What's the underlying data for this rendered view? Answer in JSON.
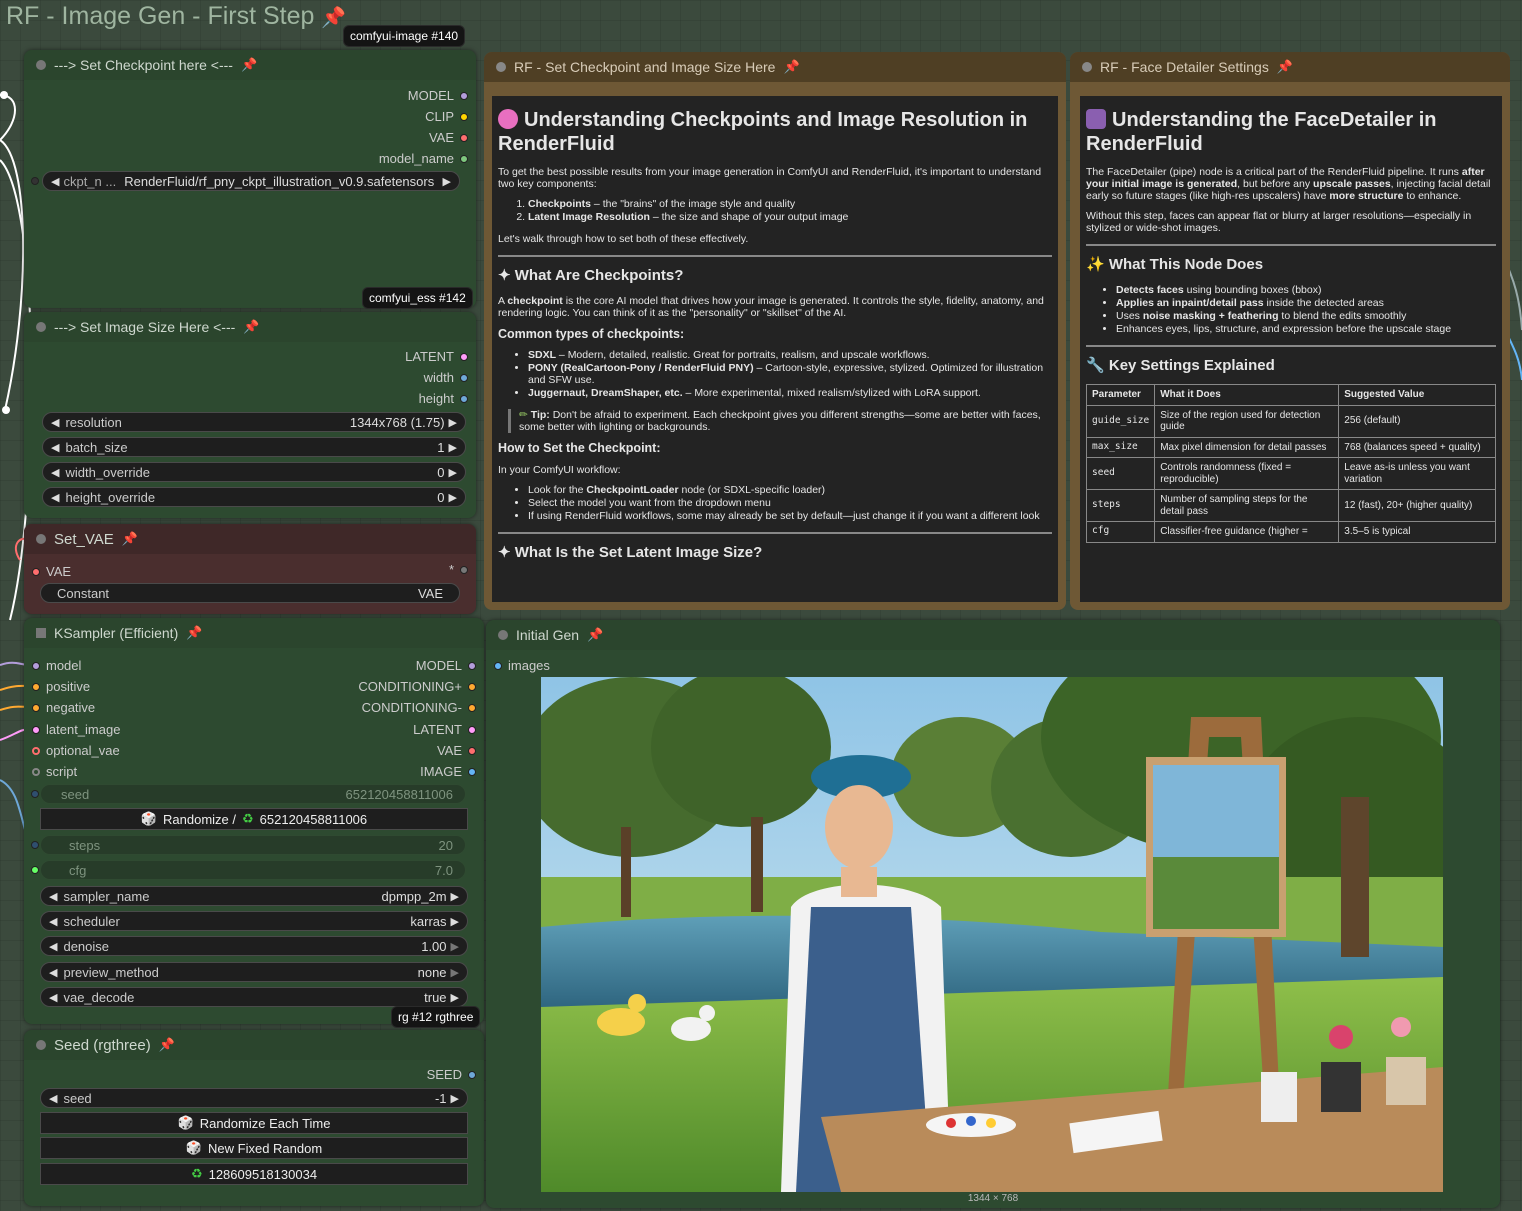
{
  "group": {
    "title": "RF - Image Gen - First Step"
  },
  "badges": {
    "b140_name": "comfyui-image",
    "b140_id": "#140",
    "b142_name": "comfyui_ess",
    "b142_id": "#142",
    "b12_name": "rg",
    "b12_id": "#12 rgthree"
  },
  "checkpoint_node": {
    "title": "---> Set Checkpoint here <---",
    "outputs": [
      "MODEL",
      "CLIP",
      "VAE",
      "model_name"
    ],
    "widget": {
      "label": "ckpt_n ...",
      "value": "RenderFluid/rf_pny_ckpt_illustration_v0.9.safetensors"
    }
  },
  "size_node": {
    "title": "---> Set Image Size Here <---",
    "outputs": [
      "LATENT",
      "width",
      "height"
    ],
    "widgets": [
      {
        "label": "resolution",
        "value": "1344x768 (1.75)"
      },
      {
        "label": "batch_size",
        "value": "1"
      },
      {
        "label": "width_override",
        "value": "0"
      },
      {
        "label": "height_override",
        "value": "0"
      }
    ]
  },
  "vae_node": {
    "title": "Set_VAE",
    "input": "VAE",
    "star": "*",
    "widget": {
      "label": "Constant",
      "value": "VAE"
    }
  },
  "ksampler": {
    "title": "KSampler (Efficient)",
    "inputs": [
      "model",
      "positive",
      "negative",
      "latent_image",
      "optional_vae",
      "script"
    ],
    "outputs": [
      "MODEL",
      "CONDITIONING+",
      "CONDITIONING-",
      "LATENT",
      "VAE",
      "IMAGE"
    ],
    "seed": {
      "label": "seed",
      "value": "652120458811006"
    },
    "randomize_label": "Randomize /",
    "randomize_value": "652120458811006",
    "steps": {
      "label": "steps",
      "value": "20"
    },
    "cfg": {
      "label": "cfg",
      "value": "7.0"
    },
    "widgets": [
      {
        "label": "sampler_name",
        "value": "dpmpp_2m"
      },
      {
        "label": "scheduler",
        "value": "karras"
      },
      {
        "label": "denoise",
        "value": "1.00"
      },
      {
        "label": "preview_method",
        "value": "none"
      },
      {
        "label": "vae_decode",
        "value": "true"
      }
    ]
  },
  "seed_node": {
    "title": "Seed (rgthree)",
    "output": "SEED",
    "seed": {
      "label": "seed",
      "value": "-1"
    },
    "btn_random": "Randomize Each Time",
    "btn_fixed": "New Fixed Random",
    "btn_last": "128609518130034"
  },
  "initial_gen": {
    "title": "Initial Gen",
    "input": "images",
    "caption": "1344 × 768"
  },
  "doc1": {
    "title": "RF - Set Checkpoint and Image Size Here",
    "h1": "Understanding Checkpoints and Image Resolution in RenderFluid",
    "intro": "To get the best possible results from your image generation in ComfyUI and RenderFluid, it's important to understand two key components:",
    "list1": [
      {
        "b": "Checkpoints",
        "t": " – the \"brains\" of the image style and quality"
      },
      {
        "b": "Latent Image Resolution",
        "t": " – the size and shape of your output image"
      }
    ],
    "walk": "Let's walk through how to set both of these effectively.",
    "h2a": "What Are Checkpoints?",
    "cp_b": "checkpoint",
    "cp_pre": "A ",
    "cp_post": " is the core AI model that drives how your image is generated. It controls the style, fidelity, anatomy, and rendering logic. You can think of it as the \"personality\" or \"skillset\" of the AI.",
    "h3a": "Common types of checkpoints:",
    "types": [
      {
        "b": "SDXL",
        "t": " – Modern, detailed, realistic. Great for portraits, realism, and upscale workflows."
      },
      {
        "b": "PONY (RealCartoon-Pony / RenderFluid PNY)",
        "t": " – Cartoon-style, expressive, stylized. Optimized for illustration and SFW use."
      },
      {
        "b": "Juggernaut, DreamShaper, etc.",
        "t": " – More experimental, mixed realism/stylized with LoRA support."
      }
    ],
    "tip_b": "Tip:",
    "tip_t": " Don't be afraid to experiment. Each checkpoint gives you different strengths—some are better with faces, some better with lighting or backgrounds.",
    "h3b": "How to Set the Checkpoint:",
    "in_wf": "In your ComfyUI workflow:",
    "steps": [
      {
        "pre": "Look for the ",
        "b": "CheckpointLoader",
        "t": " node (or SDXL-specific loader)"
      },
      {
        "pre": "Select the model you want from the dropdown menu",
        "b": "",
        "t": ""
      },
      {
        "pre": "If using RenderFluid workflows, some may already be set by default—just change it if you want a different look",
        "b": "",
        "t": ""
      }
    ],
    "h2b": "What Is the Set Latent Image Size?"
  },
  "doc2": {
    "title": "RF - Face Detailer Settings",
    "h1": "Understanding the FaceDetailer in RenderFluid",
    "p1_pre": "The FaceDetailer (pipe) node is a critical part of the RenderFluid pipeline. It runs ",
    "p1_b1": "after your initial image is generated",
    "p1_mid": ", but before any ",
    "p1_b2": "upscale passes",
    "p1_mid2": ", injecting facial detail early so future stages (like high-res upscalers) have ",
    "p1_b3": "more structure",
    "p1_end": " to enhance.",
    "p2": "Without this step, faces can appear flat or blurry at larger resolutions—especially in stylized or wide-shot images.",
    "h2a": "What This Node Does",
    "does": [
      {
        "b": "Detects faces",
        "t": " using bounding boxes (bbox)"
      },
      {
        "b": "Applies an inpaint/detail pass",
        "t": " inside the detected areas"
      },
      {
        "pre": "Uses ",
        "b": "noise masking + feathering",
        "t": " to blend the edits smoothly"
      },
      {
        "pre": "Enhances eyes, lips, structure, and expression before the upscale stage",
        "b": "",
        "t": ""
      }
    ],
    "h2b": "Key Settings Explained",
    "headers": [
      "Parameter",
      "What it Does",
      "Suggested Value"
    ],
    "rows": [
      [
        "guide_size",
        "Size of the region used for detection guide",
        "256 (default)"
      ],
      [
        "max_size",
        "Max pixel dimension for detail passes",
        "768 (balances speed + quality)"
      ],
      [
        "seed",
        "Controls randomness (fixed = reproducible)",
        "Leave as-is unless you want variation"
      ],
      [
        "steps",
        "Number of sampling steps for the detail pass",
        "12 (fast), 20+ (higher quality)"
      ],
      [
        "cfg",
        "Classifier-free guidance (higher =",
        "3.5–5 is typical"
      ]
    ]
  },
  "colors": {
    "model": "#b39ddb",
    "clip": "#ffd500",
    "vae": "#ff6e6e",
    "string": "#7ec87e",
    "latent": "#ff9cf9",
    "int": "#6ea8d8",
    "cond": "#ffa931",
    "image": "#64b5f6"
  }
}
